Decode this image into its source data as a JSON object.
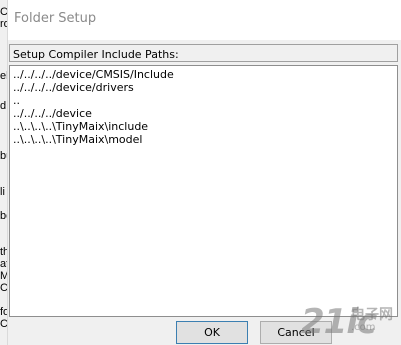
{
  "background_window": {
    "fragments": [
      "C",
      "ro",
      "",
      "",
      "el",
      "",
      "d",
      "",
      "",
      "",
      "",
      "",
      "bu",
      "",
      "li",
      "",
      "be",
      "",
      "",
      "",
      "th",
      "at",
      "M",
      "Ci",
      "",
      "",
      "fo",
      "Ci"
    ]
  },
  "dialog": {
    "title": "Folder Setup",
    "group_label": "Setup Compiler Include Paths:",
    "paths": [
      "../../../../device/CMSIS/Include",
      "../../../../device/drivers",
      "..",
      "../../../../device",
      "..\\..\\..\\..\\TinyMaix\\include",
      "..\\..\\..\\..\\TinyMaix\\model"
    ],
    "ok_label": "OK",
    "cancel_label": "Cancel"
  },
  "watermark": {
    "number": "21ic",
    "chinese": "电子网",
    "url": ".com"
  },
  "colors": {
    "dialog_bg": "#f0f0f0",
    "listbox_bg": "#ffffff",
    "title_text": "#8a8a8a",
    "button_bg": "#e1e1e1",
    "default_button_border": "#3c7fb1"
  }
}
